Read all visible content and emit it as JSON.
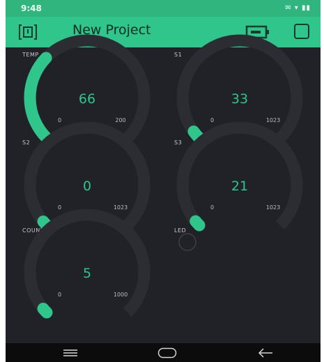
{
  "status": {
    "time": "9:48",
    "icons_right": "✉ ▾ ▮▮"
  },
  "app_bar": {
    "title": "New Project"
  },
  "colors": {
    "accent": "#2fc58b",
    "background": "#212227",
    "track": "#2c2d33"
  },
  "widgets": [
    {
      "label": "TEMP",
      "value": "66",
      "min": "0",
      "max": "200",
      "num": 66,
      "min_num": 0,
      "max_num": 200
    },
    {
      "label": "S1",
      "value": "33",
      "min": "0",
      "max": "1023",
      "num": 33,
      "min_num": 0,
      "max_num": 1023
    },
    {
      "label": "S2",
      "value": "0",
      "min": "0",
      "max": "1023",
      "num": 0,
      "min_num": 0,
      "max_num": 1023
    },
    {
      "label": "S3",
      "value": "21",
      "min": "0",
      "max": "1023",
      "num": 21,
      "min_num": 0,
      "max_num": 1023
    },
    {
      "label": "COUNT",
      "value": "5",
      "min": "0",
      "max": "1000",
      "num": 5,
      "min_num": 0,
      "max_num": 1000
    }
  ],
  "led": {
    "label": "LED"
  },
  "nav": {
    "menu_icon": "menu-icon",
    "home_icon": "home-icon",
    "back_icon": "back-arrow-icon"
  }
}
